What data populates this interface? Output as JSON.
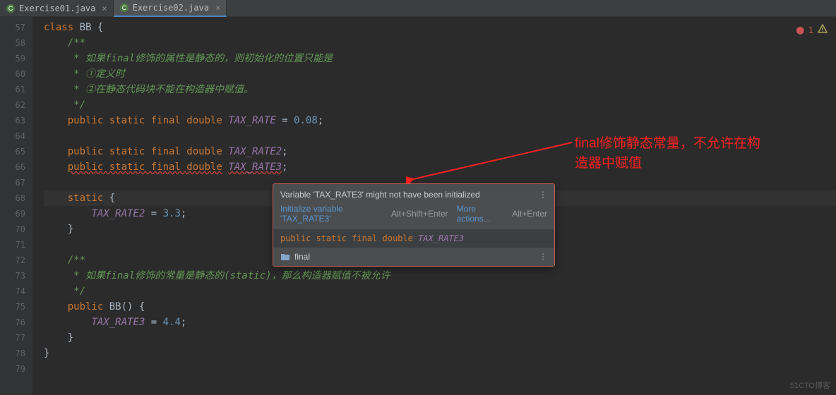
{
  "tabs": [
    {
      "label": "Exercise01.java",
      "active": false
    },
    {
      "label": "Exercise02.java",
      "active": true
    }
  ],
  "gutter": {
    "start": 57,
    "end": 79
  },
  "code": {
    "l57": {
      "kw": "class",
      "cls": "BB"
    },
    "l58": "/**",
    "l59": " * 如果final修饰的属性是静态的，则初始化的位置只能是",
    "l60": " * ①定义时",
    "l61": " * ②在静态代码块不能在构造器中赋值。",
    "l62": " */",
    "l63": {
      "mods": "public static final double",
      "name": "TAX_RATE",
      "eq": " = ",
      "val": "0.08"
    },
    "l65": {
      "mods": "public static final double",
      "name": "TAX_RATE2"
    },
    "l66": {
      "mods": "public static final double",
      "name": "TAX_RATE3"
    },
    "l68": {
      "kw": "static"
    },
    "l69": {
      "name": "TAX_RATE2",
      "eq": " = ",
      "val": "3.3"
    },
    "l72": "/**",
    "l73": " * 如果final修饰的常量是静态的(static)，那么构造器赋值不被允许",
    "l74": " */",
    "l75": {
      "kw": "public",
      "cls": "BB"
    },
    "l76": {
      "name": "TAX_RATE3",
      "eq": " = ",
      "val": "4.4"
    }
  },
  "tooltip": {
    "title": "Variable 'TAX_RATE3' might not have been initialized",
    "action1": "Initialize variable 'TAX_RATE3'",
    "shortcut1": "Alt+Shift+Enter",
    "more": "More actions...",
    "shortcut2": "Alt+Enter",
    "code_mods": "public static final double",
    "code_name": "TAX_RATE3",
    "footer": "final"
  },
  "annotation": {
    "line1": "final修饰静态常量，不允许在构",
    "line2": "造器中赋值"
  },
  "errors": {
    "count": "1"
  },
  "watermark": "51CTO博客"
}
